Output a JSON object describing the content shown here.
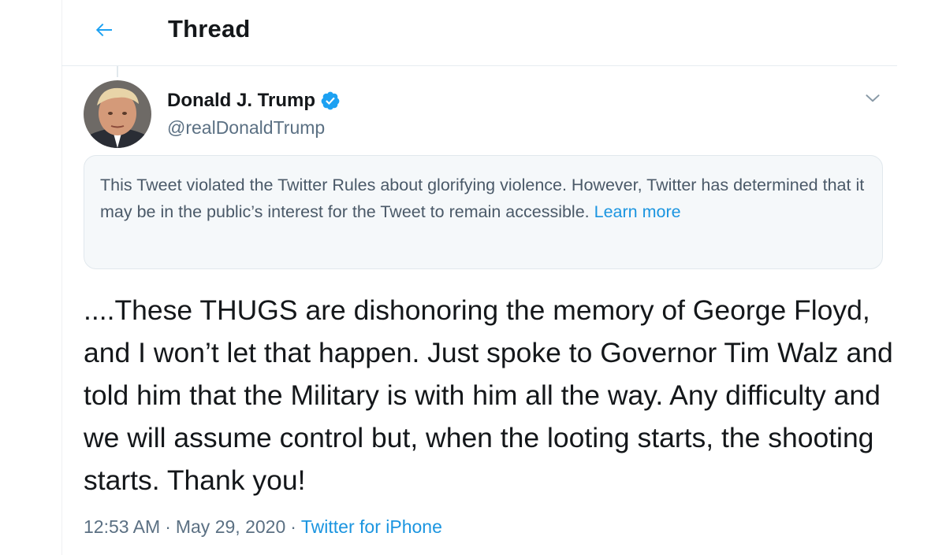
{
  "header": {
    "title": "Thread",
    "back_icon": "arrow-left-icon",
    "accent_color": "#1da1f2"
  },
  "tweet": {
    "author": {
      "display_name": "Donald J. Trump",
      "handle": "@realDonaldTrump",
      "verified": true,
      "verified_icon": "verified-badge-icon"
    },
    "more_icon": "chevron-down-icon",
    "notice": {
      "text": "This Tweet violated the Twitter Rules about glorifying violence. However, Twitter has determined that it may be in the public’s interest for the Tweet to remain accessible.",
      "link_label": "Learn more"
    },
    "body": "....These THUGS are dishonoring the memory of George Floyd, and I won’t let that happen. Just spoke to Governor Tim Walz and told him that the Military is with him all the way. Any difficulty and we will assume control but, when the looting starts, the shooting starts. Thank you!",
    "time": "12:53 AM",
    "separator": "·",
    "date": "May 29, 2020",
    "source": "Twitter for iPhone"
  }
}
